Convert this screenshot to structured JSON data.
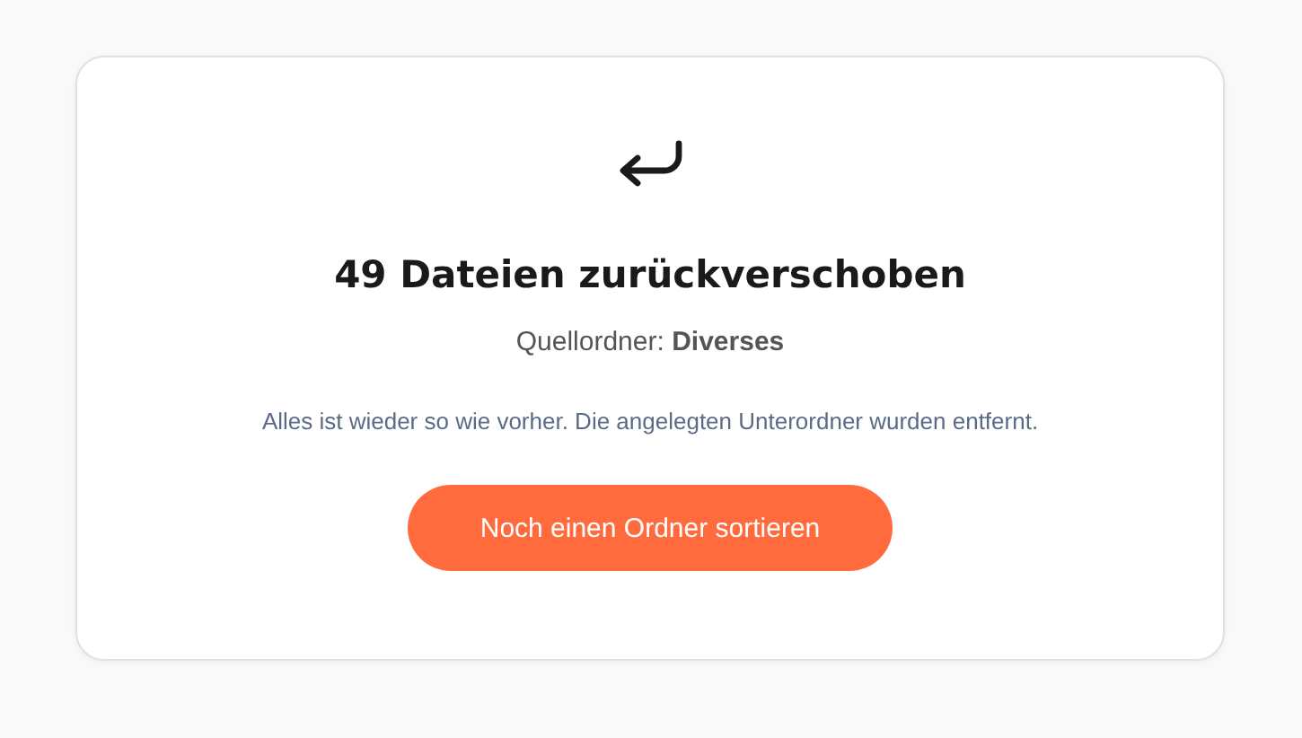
{
  "card": {
    "title": "49 Dateien zurückverschoben",
    "source": "Quellordner: **Diverses**",
    "message": "Alles ist wieder so wie vorher. Die angelegten Unterordner wurden entfernt.",
    "button": "Noch einen Ordner sortieren"
  }
}
